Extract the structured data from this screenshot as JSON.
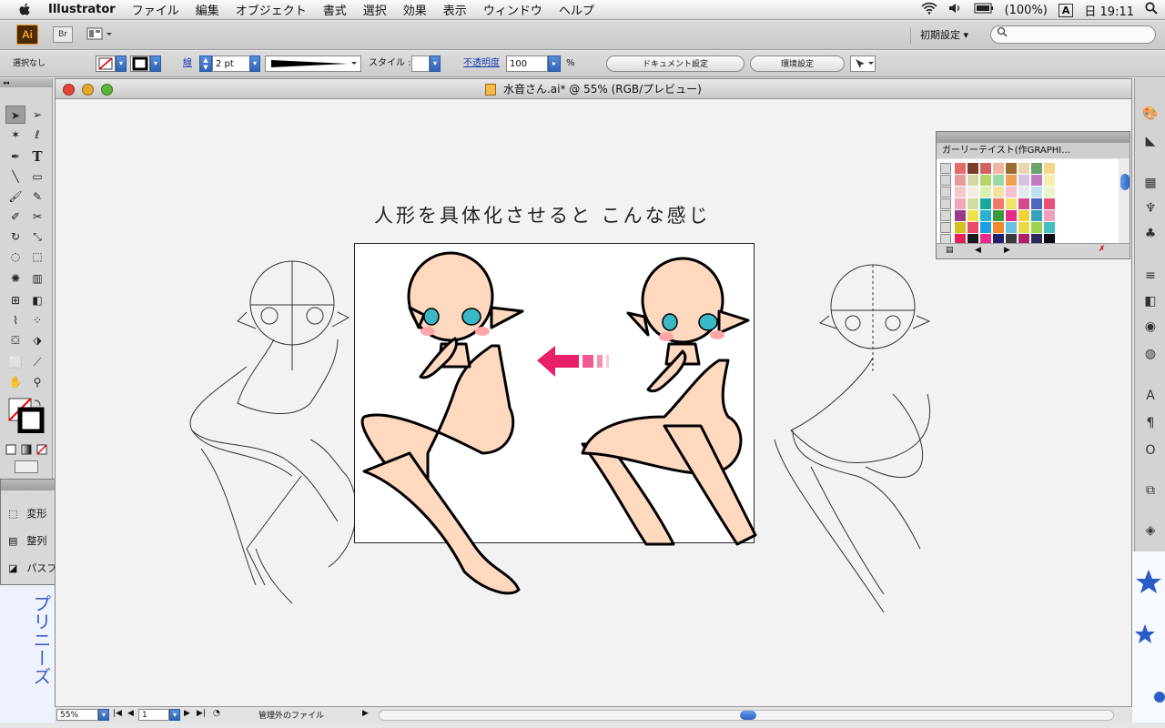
{
  "menubar": {
    "app_name": "Illustrator",
    "items": [
      "ファイル",
      "編集",
      "オブジェクト",
      "書式",
      "選択",
      "効果",
      "表示",
      "ウィンドウ",
      "ヘルプ"
    ],
    "battery": "(100%)",
    "input_indicator": "A",
    "clock": "日 19:11"
  },
  "appbar": {
    "logo": "Ai",
    "bridge": "Br",
    "workspace": "初期設定 ▾",
    "search_placeholder": ""
  },
  "control": {
    "selection": "選択なし",
    "stroke_label": "線",
    "stroke_weight": "2 pt",
    "style_label": "スタイル :",
    "opacity_label": "不透明度",
    "opacity_value": "100",
    "opacity_unit": "%",
    "doc_settings": "ドキュメント設定",
    "env_settings": "環境設定"
  },
  "document": {
    "title": "水音さん.ai* @ 55% (RGB/プレビュー)",
    "caption": "人形を具体化させると こんな感じ"
  },
  "swatches": {
    "panel_name": "ガーリーテイスト(作GRAPHI…",
    "rows": [
      [
        "#e36b6b",
        "#7a3b2a",
        "#d46060",
        "#f2b5a0",
        "#9e6b2e",
        "#e9d5b0",
        "#6aa36b",
        "#f5d58a"
      ],
      [
        "#e89a9a",
        "#d4d6a8",
        "#b7d46b",
        "#9bd8a5",
        "#f0a050",
        "#d4c2e0",
        "#c07ac0",
        "#f6f0b0"
      ],
      [
        "#f4c8c8",
        "#f2eee0",
        "#d9f0b0",
        "#f4e0a0",
        "#f4c0d0",
        "#e0eaf0",
        "#c0e0f0",
        "#e8f6d0"
      ],
      [
        "#f2a6b8",
        "#cfe0a0",
        "#1aa89a",
        "#f07a6a",
        "#f2e46a",
        "#d44a8a",
        "#4a68c0",
        "#e8507a"
      ],
      [
        "#9a3a8a",
        "#f2e24a",
        "#2ab0d0",
        "#3a9a3a",
        "#e82a8a",
        "#f2d23a",
        "#3aa0c0",
        "#f2a0c0"
      ],
      [
        "#d4c020",
        "#e84a6a",
        "#1aa0e0",
        "#f08a2a",
        "#6ac0e0",
        "#e8d84a",
        "#a0d050",
        "#40c0c0"
      ],
      [
        "#e8205a",
        "#1a1a1a",
        "#ef2a8a",
        "#202070",
        "#3a3a3a",
        "#b0206a",
        "#2a2a5a",
        "#0a0a0a"
      ]
    ]
  },
  "float_panel": {
    "items": [
      "変形",
      "整列",
      "パスファインダ"
    ]
  },
  "status": {
    "zoom": "55%",
    "page": "1",
    "info": "管理外のファイル"
  },
  "wallpaper_text": "プリニーズ"
}
